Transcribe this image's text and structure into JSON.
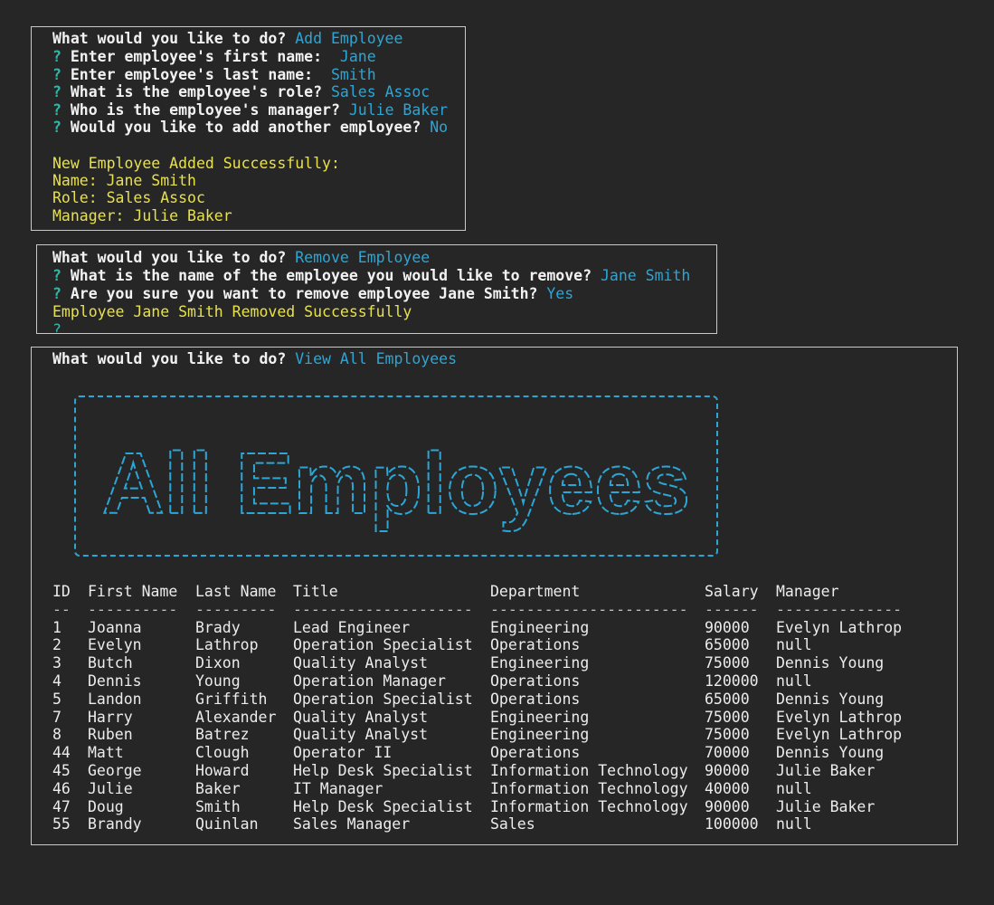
{
  "add_panel": {
    "prompt": "What would you like to do?",
    "choice": "Add Employee",
    "questions": [
      {
        "q": "Enter employee's first name: ",
        "a": " Jane"
      },
      {
        "q": "Enter employee's last name: ",
        "a": " Smith"
      },
      {
        "q": "What is the employee's role?",
        "a": "Sales Assoc"
      },
      {
        "q": "Who is the employee's manager?",
        "a": "Julie Baker"
      },
      {
        "q": "Would you like to add another employee?",
        "a": "No"
      }
    ],
    "result_heading": "New Employee Added Successfully:",
    "result_lines": [
      "Name: Jane Smith",
      "Role: Sales Assoc",
      "Manager: Julie Baker"
    ]
  },
  "remove_panel": {
    "prompt": "What would you like to do?",
    "choice": "Remove Employee",
    "questions": [
      {
        "q": "What is the name of the employee you would like to remove?",
        "a": "Jane Smith"
      },
      {
        "q": "Are you sure you want to remove employee Jane Smith?",
        "a": "Yes"
      }
    ],
    "result": "Employee Jane Smith Removed Successfully",
    "cursor": "?"
  },
  "view_panel": {
    "prompt": "What would you like to do?",
    "choice": "View All Employees",
    "banner_text": "All Employees",
    "banner_color": "#2ba6d6",
    "table": {
      "headers": [
        "ID",
        "First Name",
        "Last Name",
        "Title",
        "Department",
        "Salary",
        "Manager"
      ],
      "separators": [
        "--",
        "----------",
        "---------",
        "--------------------",
        "----------------------",
        "------",
        "--------------"
      ],
      "rows": [
        [
          "1",
          "Joanna",
          "Brady",
          "Lead Engineer",
          "Engineering",
          "90000",
          "Evelyn Lathrop"
        ],
        [
          "2",
          "Evelyn",
          "Lathrop",
          "Operation Specialist",
          "Operations",
          "65000",
          "null"
        ],
        [
          "3",
          "Butch",
          "Dixon",
          "Quality Analyst",
          "Engineering",
          "75000",
          "Dennis Young"
        ],
        [
          "4",
          "Dennis",
          "Young",
          "Operation Manager",
          "Operations",
          "120000",
          "null"
        ],
        [
          "5",
          "Landon",
          "Griffith",
          "Operation Specialist",
          "Operations",
          "65000",
          "Dennis Young"
        ],
        [
          "7",
          "Harry",
          "Alexander",
          "Quality Analyst",
          "Engineering",
          "75000",
          "Evelyn Lathrop"
        ],
        [
          "8",
          "Ruben",
          "Batrez",
          "Quality Analyst",
          "Engineering",
          "75000",
          "Evelyn Lathrop"
        ],
        [
          "44",
          "Matt",
          "Clough",
          "Operator II",
          "Operations",
          "70000",
          "Dennis Young"
        ],
        [
          "45",
          "George",
          "Howard",
          "Help Desk Specialist",
          "Information Technology",
          "90000",
          "Julie Baker"
        ],
        [
          "46",
          "Julie",
          "Baker",
          "IT Manager",
          "Information Technology",
          "40000",
          "null"
        ],
        [
          "47",
          "Doug",
          "Smith",
          "Help Desk Specialist",
          "Information Technology",
          "90000",
          "Julie Baker"
        ],
        [
          "55",
          "Brandy",
          "Quinlan",
          "Sales Manager",
          "Sales",
          "100000",
          "null"
        ]
      ]
    }
  },
  "colors": {
    "background": "#262626",
    "answer": "#2ba6d6",
    "question_mark": "#2fb8a8",
    "success": "#e8e14a",
    "border": "#c9c9c9"
  }
}
